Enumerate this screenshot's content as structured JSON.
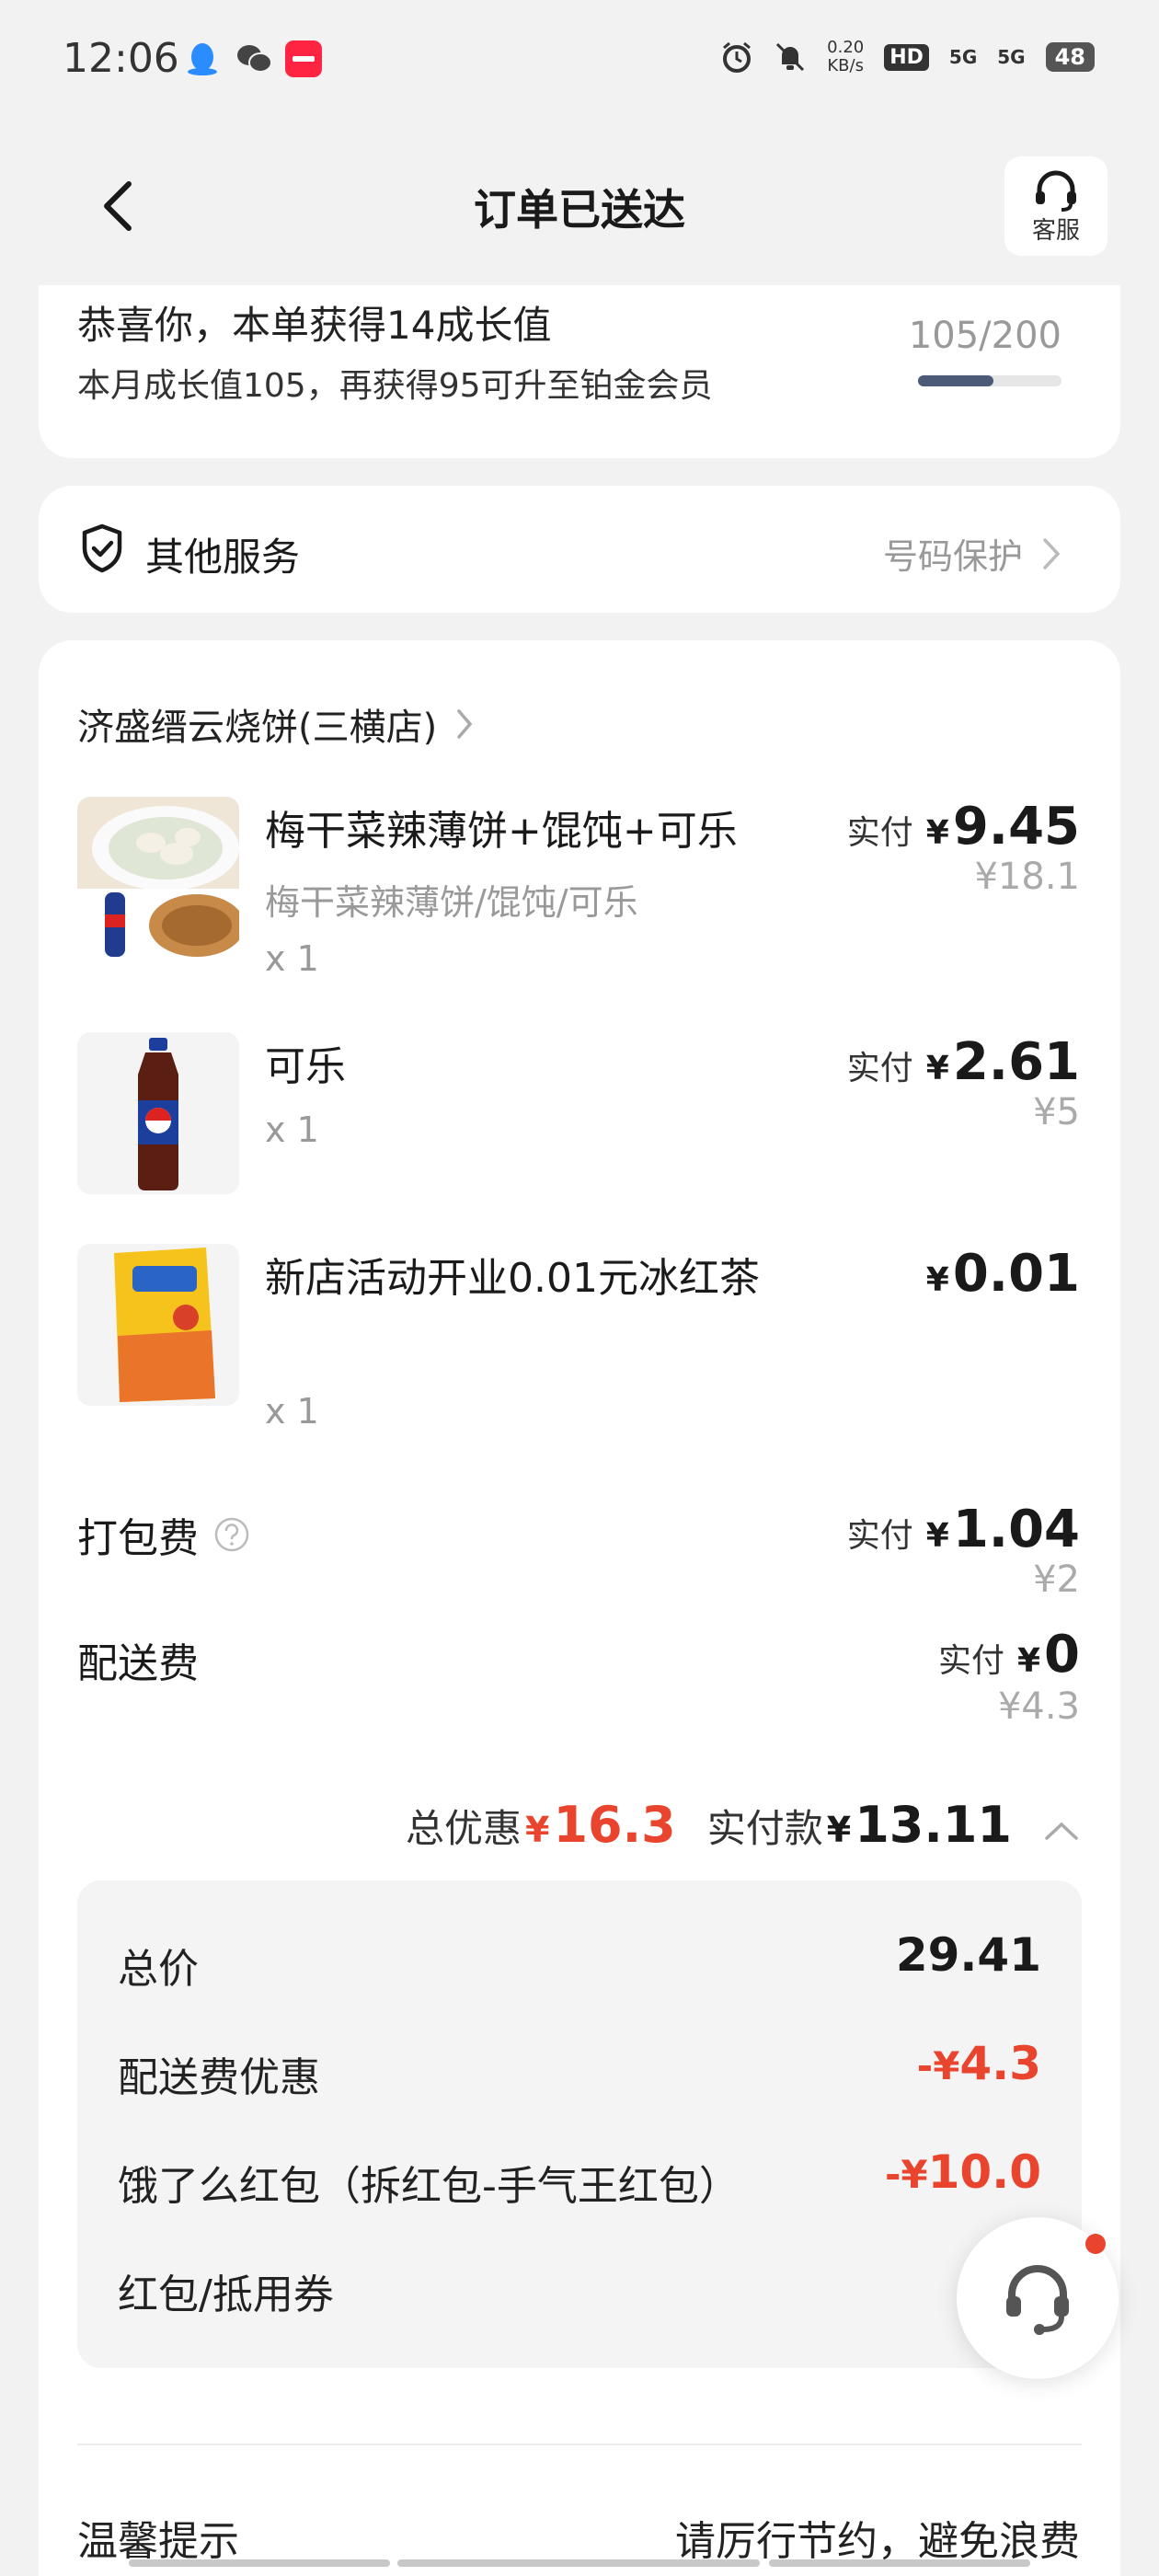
{
  "status_bar": {
    "time": "12:06",
    "net_speed_value": "0.20",
    "net_speed_unit": "KB/s",
    "hd_badge": "HD",
    "signal1": "5G",
    "signal2": "5G",
    "battery": "48"
  },
  "header": {
    "title": "订单已送达",
    "service_label": "客服"
  },
  "growth": {
    "title": "恭喜你，本单获得14成长值",
    "subtitle": "本月成长值105，再获得95可升至铂金会员",
    "progress_text": "105/200",
    "progress_fraction": 0.525
  },
  "services": {
    "label": "其他服务",
    "right_text": "号码保护"
  },
  "store": {
    "name": "济盛缙云烧饼(三横店)"
  },
  "items": [
    {
      "name": "梅干菜辣薄饼+馄饨+可乐",
      "spec": "梅干菜辣薄饼/馄饨/可乐",
      "qty": "x 1",
      "price_label": "实付",
      "currency": "¥",
      "price": "9.45",
      "orig_price": "¥18.1"
    },
    {
      "name": "可乐",
      "qty": "x 1",
      "price_label": "实付",
      "currency": "¥",
      "price": "2.61",
      "orig_price": "¥5"
    },
    {
      "name": "新店活动开业0.01元冰红茶",
      "qty": "x 1",
      "currency": "¥",
      "price": "0.01"
    }
  ],
  "fees": {
    "packing_label": "打包费",
    "packing_price_label": "实付",
    "packing_currency": "¥",
    "packing_price": "1.04",
    "packing_orig": "¥2",
    "delivery_label": "配送费",
    "delivery_price_label": "实付",
    "delivery_currency": "¥",
    "delivery_price": "0",
    "delivery_orig": "¥4.3"
  },
  "summary": {
    "discount_label": "总优惠",
    "discount_currency": "¥",
    "discount_value": "16.3",
    "paid_label": "实付款",
    "paid_currency": "¥",
    "paid_value": "13.11"
  },
  "breakdown": {
    "total_label": "总价",
    "total_value": "29.41",
    "delivery_discount_label": "配送费优惠",
    "delivery_discount_sign": "-¥",
    "delivery_discount_value": "4.3",
    "redpacket_label": "饿了么红包（拆红包-手气王红包）",
    "redpacket_sign": "-¥",
    "redpacket_value": "10.0",
    "coupon_label": "红包/抵用券",
    "coupon_sign": "-¥"
  },
  "tips": {
    "label": "温馨提示",
    "text": "请厉行节约，避免浪费"
  }
}
